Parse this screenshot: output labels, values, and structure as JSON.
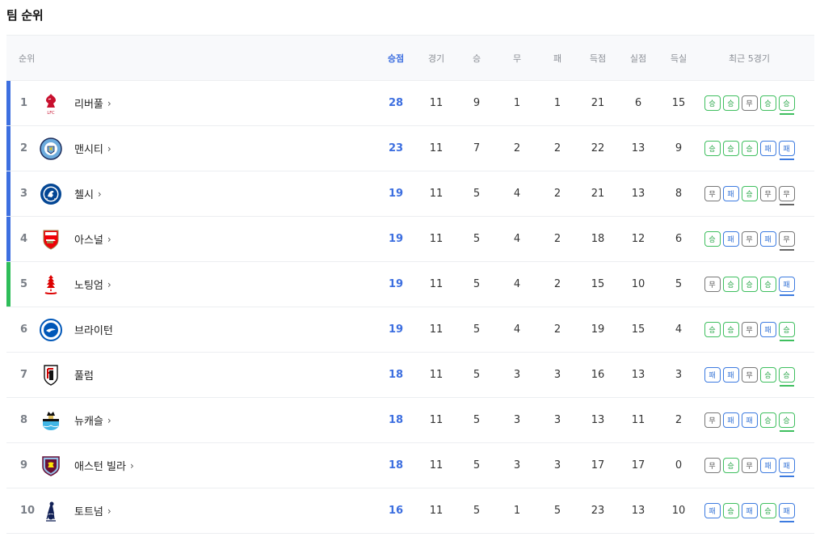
{
  "title": "팀 순위",
  "headers": {
    "rank": "순위",
    "points": "승점",
    "played": "경기",
    "won": "승",
    "drawn": "무",
    "lost": "패",
    "gf": "득점",
    "ga": "실점",
    "gd": "득실",
    "form": "최근 5경기"
  },
  "colors": {
    "accent": "#3d6fe0",
    "ucl_bar": "#3d6fe0",
    "uel_bar": "#2ebd59",
    "win": "#3fbf5f",
    "draw": "#777777",
    "loss": "#3d7be0"
  },
  "teams": [
    {
      "rank": "1",
      "name": "리버풀",
      "arrow": "›",
      "crest": "liverpool-crest-icon",
      "zone": "ucl",
      "points": "28",
      "played": "11",
      "won": "9",
      "drawn": "1",
      "lost": "1",
      "gf": "21",
      "ga": "6",
      "gd": "15",
      "form": [
        {
          "label": "승",
          "result": "w"
        },
        {
          "label": "승",
          "result": "w"
        },
        {
          "label": "무",
          "result": "d"
        },
        {
          "label": "승",
          "result": "w"
        },
        {
          "label": "승",
          "result": "w"
        }
      ]
    },
    {
      "rank": "2",
      "name": "맨시티",
      "arrow": "›",
      "crest": "man-city-crest-icon",
      "zone": "ucl",
      "points": "23",
      "played": "11",
      "won": "7",
      "drawn": "2",
      "lost": "2",
      "gf": "22",
      "ga": "13",
      "gd": "9",
      "form": [
        {
          "label": "승",
          "result": "w"
        },
        {
          "label": "승",
          "result": "w"
        },
        {
          "label": "승",
          "result": "w"
        },
        {
          "label": "패",
          "result": "l"
        },
        {
          "label": "패",
          "result": "l"
        }
      ]
    },
    {
      "rank": "3",
      "name": "첼시",
      "arrow": "›",
      "crest": "chelsea-crest-icon",
      "zone": "ucl",
      "points": "19",
      "played": "11",
      "won": "5",
      "drawn": "4",
      "lost": "2",
      "gf": "21",
      "ga": "13",
      "gd": "8",
      "form": [
        {
          "label": "무",
          "result": "d"
        },
        {
          "label": "패",
          "result": "l"
        },
        {
          "label": "승",
          "result": "w"
        },
        {
          "label": "무",
          "result": "d"
        },
        {
          "label": "무",
          "result": "d"
        }
      ]
    },
    {
      "rank": "4",
      "name": "아스널",
      "arrow": "›",
      "crest": "arsenal-crest-icon",
      "zone": "ucl",
      "points": "19",
      "played": "11",
      "won": "5",
      "drawn": "4",
      "lost": "2",
      "gf": "18",
      "ga": "12",
      "gd": "6",
      "form": [
        {
          "label": "승",
          "result": "w"
        },
        {
          "label": "패",
          "result": "l"
        },
        {
          "label": "무",
          "result": "d"
        },
        {
          "label": "패",
          "result": "l"
        },
        {
          "label": "무",
          "result": "d"
        }
      ]
    },
    {
      "rank": "5",
      "name": "노팅엄",
      "arrow": "›",
      "crest": "nottingham-forest-crest-icon",
      "zone": "uel",
      "points": "19",
      "played": "11",
      "won": "5",
      "drawn": "4",
      "lost": "2",
      "gf": "15",
      "ga": "10",
      "gd": "5",
      "form": [
        {
          "label": "무",
          "result": "d"
        },
        {
          "label": "승",
          "result": "w"
        },
        {
          "label": "승",
          "result": "w"
        },
        {
          "label": "승",
          "result": "w"
        },
        {
          "label": "패",
          "result": "l"
        }
      ]
    },
    {
      "rank": "6",
      "name": "브라이턴",
      "arrow": "",
      "crest": "brighton-crest-icon",
      "zone": "",
      "points": "19",
      "played": "11",
      "won": "5",
      "drawn": "4",
      "lost": "2",
      "gf": "19",
      "ga": "15",
      "gd": "4",
      "form": [
        {
          "label": "승",
          "result": "w"
        },
        {
          "label": "승",
          "result": "w"
        },
        {
          "label": "무",
          "result": "d"
        },
        {
          "label": "패",
          "result": "l"
        },
        {
          "label": "승",
          "result": "w"
        }
      ]
    },
    {
      "rank": "7",
      "name": "풀럼",
      "arrow": "",
      "crest": "fulham-crest-icon",
      "zone": "",
      "points": "18",
      "played": "11",
      "won": "5",
      "drawn": "3",
      "lost": "3",
      "gf": "16",
      "ga": "13",
      "gd": "3",
      "form": [
        {
          "label": "패",
          "result": "l"
        },
        {
          "label": "패",
          "result": "l"
        },
        {
          "label": "무",
          "result": "d"
        },
        {
          "label": "승",
          "result": "w"
        },
        {
          "label": "승",
          "result": "w"
        }
      ]
    },
    {
      "rank": "8",
      "name": "뉴캐슬",
      "arrow": "›",
      "crest": "newcastle-crest-icon",
      "zone": "",
      "points": "18",
      "played": "11",
      "won": "5",
      "drawn": "3",
      "lost": "3",
      "gf": "13",
      "ga": "11",
      "gd": "2",
      "form": [
        {
          "label": "무",
          "result": "d"
        },
        {
          "label": "패",
          "result": "l"
        },
        {
          "label": "패",
          "result": "l"
        },
        {
          "label": "승",
          "result": "w"
        },
        {
          "label": "승",
          "result": "w"
        }
      ]
    },
    {
      "rank": "9",
      "name": "애스턴 빌라",
      "arrow": "›",
      "crest": "aston-villa-crest-icon",
      "zone": "",
      "points": "18",
      "played": "11",
      "won": "5",
      "drawn": "3",
      "lost": "3",
      "gf": "17",
      "ga": "17",
      "gd": "0",
      "form": [
        {
          "label": "무",
          "result": "d"
        },
        {
          "label": "승",
          "result": "w"
        },
        {
          "label": "무",
          "result": "d"
        },
        {
          "label": "패",
          "result": "l"
        },
        {
          "label": "패",
          "result": "l"
        }
      ]
    },
    {
      "rank": "10",
      "name": "토트넘",
      "arrow": "›",
      "crest": "tottenham-crest-icon",
      "zone": "",
      "points": "16",
      "played": "11",
      "won": "5",
      "drawn": "1",
      "lost": "5",
      "gf": "23",
      "ga": "13",
      "gd": "10",
      "form": [
        {
          "label": "패",
          "result": "l"
        },
        {
          "label": "승",
          "result": "w"
        },
        {
          "label": "패",
          "result": "l"
        },
        {
          "label": "승",
          "result": "w"
        },
        {
          "label": "패",
          "result": "l"
        }
      ]
    }
  ]
}
